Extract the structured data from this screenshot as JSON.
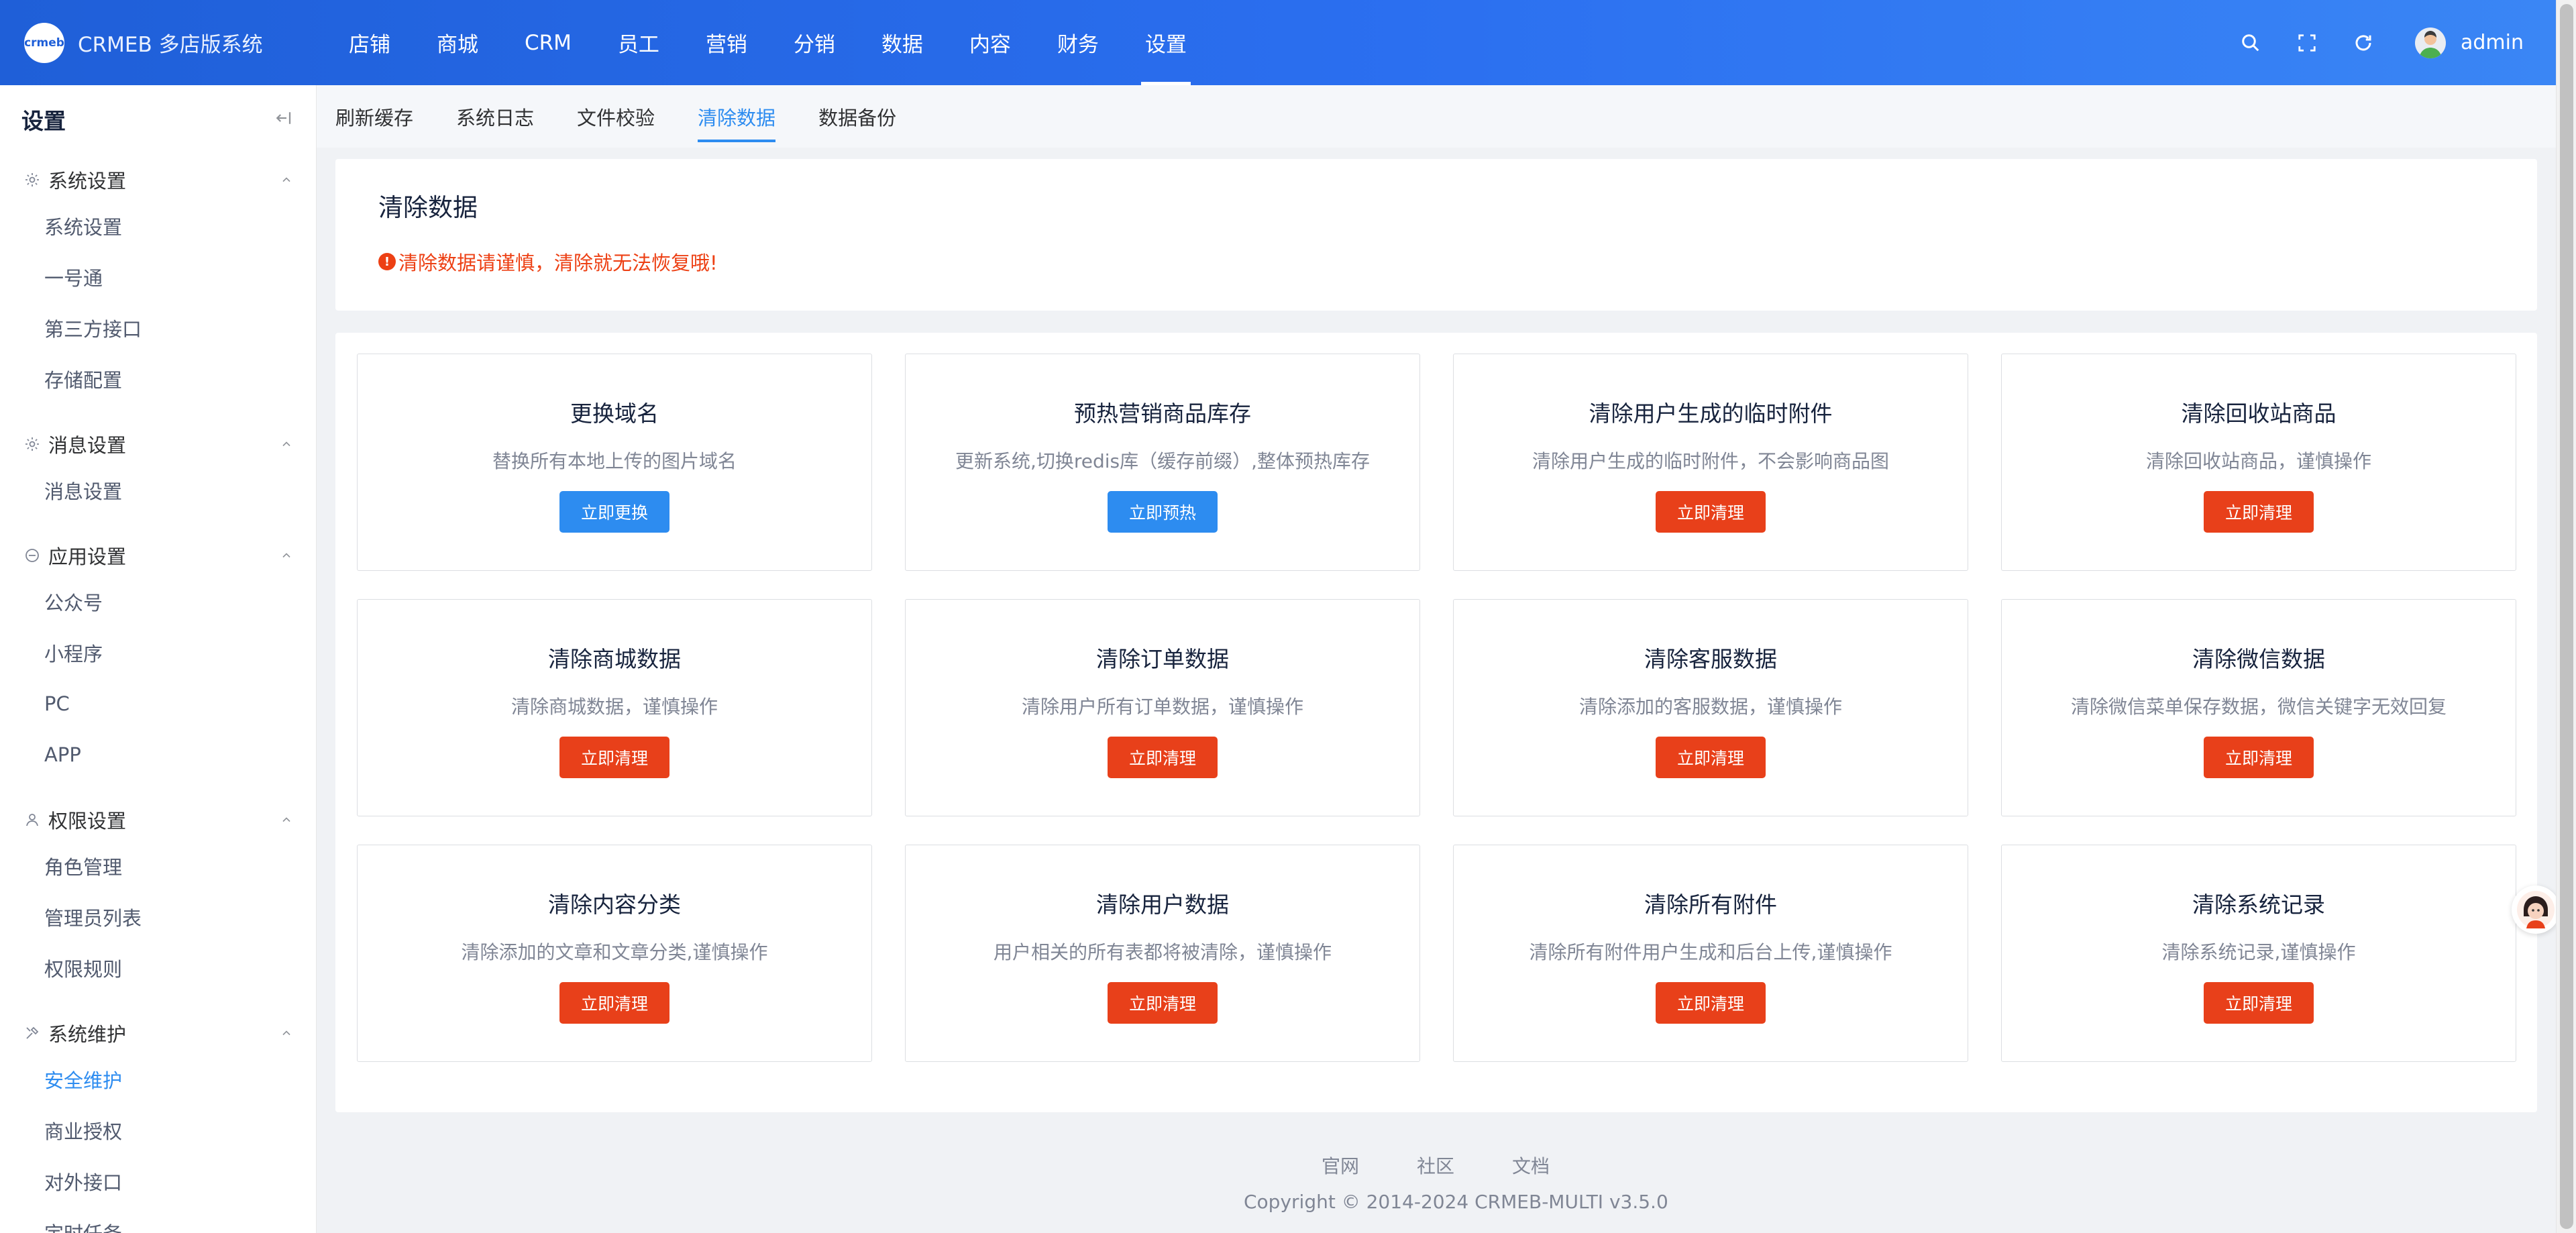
{
  "app": {
    "title": "CRMEB 多店版系统",
    "logo_text": "crmeb"
  },
  "topnav": {
    "items": [
      "店铺",
      "商城",
      "CRM",
      "员工",
      "营销",
      "分销",
      "数据",
      "内容",
      "财务",
      "设置"
    ],
    "active_index": 9,
    "user": "admin"
  },
  "sidebar": {
    "title": "设置",
    "groups": [
      {
        "label": "系统设置",
        "icon": "gear-icon",
        "items": [
          "系统设置",
          "一号通",
          "第三方接口",
          "存储配置"
        ]
      },
      {
        "label": "消息设置",
        "icon": "gear-icon",
        "items": [
          "消息设置"
        ]
      },
      {
        "label": "应用设置",
        "icon": "app-icon",
        "items": [
          "公众号",
          "小程序",
          "PC",
          "APP"
        ]
      },
      {
        "label": "权限设置",
        "icon": "user-icon",
        "items": [
          "角色管理",
          "管理员列表",
          "权限规则"
        ]
      },
      {
        "label": "系统维护",
        "icon": "tools-icon",
        "items": [
          "安全维护",
          "商业授权",
          "对外接口",
          "定时任务"
        ]
      }
    ],
    "active_item": "安全维护"
  },
  "tabs": {
    "items": [
      "刷新缓存",
      "系统日志",
      "文件校验",
      "清除数据",
      "数据备份"
    ],
    "active_index": 3
  },
  "notice": {
    "title": "清除数据",
    "warning": "清除数据请谨慎，清除就无法恢复哦!"
  },
  "cards": [
    {
      "title": "更换域名",
      "desc": "替换所有本地上传的图片域名",
      "button": "立即更换",
      "color": "blue"
    },
    {
      "title": "预热营销商品库存",
      "desc": "更新系统,切换redis库（缓存前缀）,整体预热库存",
      "button": "立即预热",
      "color": "blue"
    },
    {
      "title": "清除用户生成的临时附件",
      "desc": "清除用户生成的临时附件，不会影响商品图",
      "button": "立即清理",
      "color": "red"
    },
    {
      "title": "清除回收站商品",
      "desc": "清除回收站商品，谨慎操作",
      "button": "立即清理",
      "color": "red"
    },
    {
      "title": "清除商城数据",
      "desc": "清除商城数据，谨慎操作",
      "button": "立即清理",
      "color": "red"
    },
    {
      "title": "清除订单数据",
      "desc": "清除用户所有订单数据，谨慎操作",
      "button": "立即清理",
      "color": "red"
    },
    {
      "title": "清除客服数据",
      "desc": "清除添加的客服数据，谨慎操作",
      "button": "立即清理",
      "color": "red"
    },
    {
      "title": "清除微信数据",
      "desc": "清除微信菜单保存数据，微信关键字无效回复",
      "button": "立即清理",
      "color": "red"
    },
    {
      "title": "清除内容分类",
      "desc": "清除添加的文章和文章分类,谨慎操作",
      "button": "立即清理",
      "color": "red"
    },
    {
      "title": "清除用户数据",
      "desc": "用户相关的所有表都将被清除，谨慎操作",
      "button": "立即清理",
      "color": "red"
    },
    {
      "title": "清除所有附件",
      "desc": "清除所有附件用户生成和后台上传,谨慎操作",
      "button": "立即清理",
      "color": "red"
    },
    {
      "title": "清除系统记录",
      "desc": "清除系统记录,谨慎操作",
      "button": "立即清理",
      "color": "red"
    }
  ],
  "footer": {
    "links": [
      "官网",
      "社区",
      "文档"
    ],
    "copyright": "Copyright © 2014-2024 CRMEB-MULTI v3.5.0"
  },
  "colors": {
    "primary": "#2d8cf0",
    "danger": "#e8401a",
    "header": "#2b6ff0"
  }
}
